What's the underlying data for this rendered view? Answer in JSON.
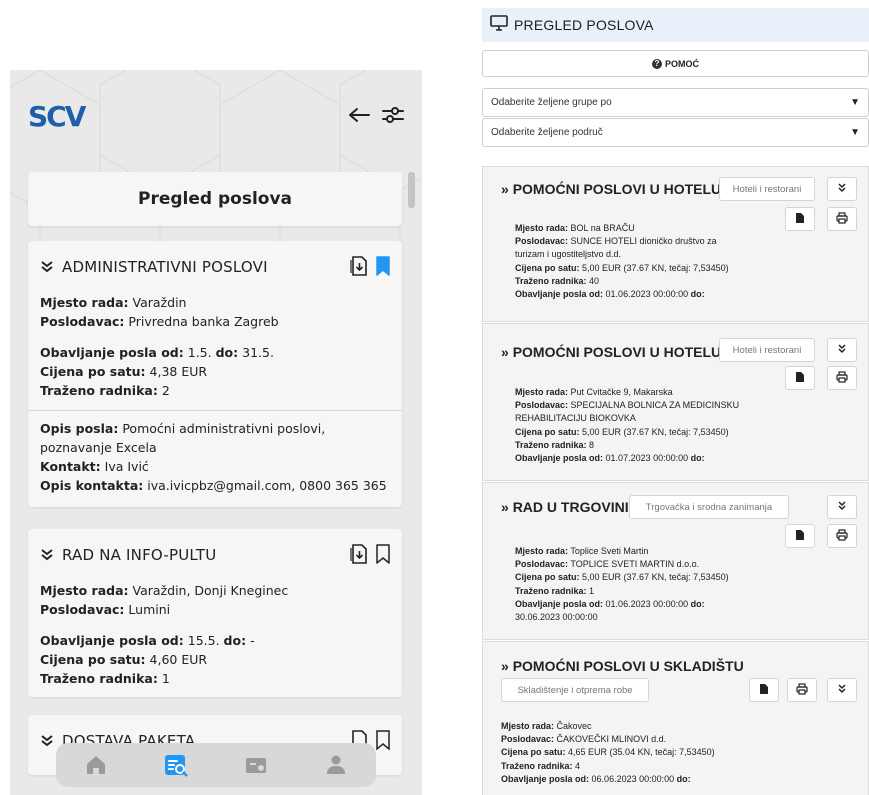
{
  "mobile": {
    "logo": "SCV",
    "title": "Pregled poslova",
    "jobs": [
      {
        "title": "ADMINISTRATIVNI POSLOVI",
        "bookmarked": true,
        "mjesto_label": "Mjesto rada:",
        "mjesto": "Varaždin",
        "poslodavac_label": "Poslodavac:",
        "poslodavac": "Privredna banka Zagreb",
        "od_label": "Obavljanje posla od:",
        "od": "1.5.",
        "do_label": "do:",
        "do": "31.5.",
        "cijena_label": "Cijena po satu:",
        "cijena": "4,38 EUR",
        "radnika_label": "Traženo radnika:",
        "radnika": "2",
        "opis_label": "Opis posla:",
        "opis": "Pomoćni administrativni poslovi, poznavanje Excela",
        "kontakt_label": "Kontakt:",
        "kontakt": "Iva Ivić",
        "opis_kontakta_label": "Opis kontakta:",
        "opis_kontakta": "iva.ivicpbz@gmail.com, 0800 365 365"
      },
      {
        "title": "RAD NA INFO-PULTU",
        "bookmarked": false,
        "mjesto_label": "Mjesto rada:",
        "mjesto": "Varaždin, Donji Kneginec",
        "poslodavac_label": "Poslodavac:",
        "poslodavac": "Lumini",
        "od_label": "Obavljanje posla od:",
        "od": "15.5.",
        "do_label": "do:",
        "do": "-",
        "cijena_label": "Cijena po satu:",
        "cijena": "4,60 EUR",
        "radnika_label": "Traženo radnika:",
        "radnika": "1"
      },
      {
        "title": "DOSTAVA PAKETA"
      }
    ],
    "nav": [
      "home-icon",
      "job-search-icon",
      "wallet-icon",
      "profile-icon"
    ],
    "colors": {
      "brand": "#1f5fa8",
      "accent": "#2196f3",
      "background": "#e9e9e9"
    }
  },
  "web": {
    "header": "PREGLED POSLOVA",
    "help": "POMOĆ",
    "select_groups": "Odaberite željene grupe po",
    "select_areas": "Odaberite željene područ",
    "labels": {
      "mjesto": "Mjesto rada:",
      "poslodavac": "Poslodavac:",
      "cijena": "Cijena po satu:",
      "radnika": "Traženo radnika:",
      "od": "Obavljanje posla od:",
      "do": "do:"
    },
    "jobs": [
      {
        "title": "POMOĆNI POSLOVI U HOTELU",
        "tag": "Hoteli i restorani",
        "mjesto": "BOL na BRAČU",
        "poslodavac_1": "SUNCE HOTELI dioničko društvo za",
        "poslodavac_2": "turizam i ugostiteljstvo d.d.",
        "cijena": "5,00 EUR (37.67 KN, tečaj: 7,53450)",
        "radnika": "40",
        "od": "01.06.2023 00:00:00"
      },
      {
        "title": "POMOĆNI POSLOVI U HOTELU",
        "tag": "Hoteli i restorani",
        "mjesto": "Put Cvitačke 9, Makarska",
        "poslodavac_1": "SPECIJALNA BOLNICA ZA MEDICINSKU",
        "poslodavac_2": "REHABILITACIJU BIOKOVKA",
        "cijena": "5,00 EUR (37.67 KN, tečaj: 7,53450)",
        "radnika": "8",
        "od": "01.07.2023 00:00:00"
      },
      {
        "title": "RAD U TRGOVINI",
        "tag": "Trgovačka i srodna zanimanja",
        "mjesto": "Toplice Sveti Martin",
        "poslodavac_1": "TOPLICE SVETI MARTIN d.o.o.",
        "cijena": "5,00 EUR (37.67 KN, tečaj: 7,53450)",
        "radnika": "1",
        "od": "01.06.2023 00:00:00",
        "do": "30.06.2023 00:00:00"
      },
      {
        "title": "POMOĆNI POSLOVI U SKLADIŠTU",
        "tag": "Skladištenje i otprema robe",
        "mjesto": "Čakovec",
        "poslodavac_1": "ČAKOVEČKI MLINOVI d.d.",
        "cijena": "4,65 EUR (35.04 KN, tečaj: 7,53450)",
        "radnika": "4",
        "od": "06.06.2023 00:00:00"
      }
    ]
  }
}
